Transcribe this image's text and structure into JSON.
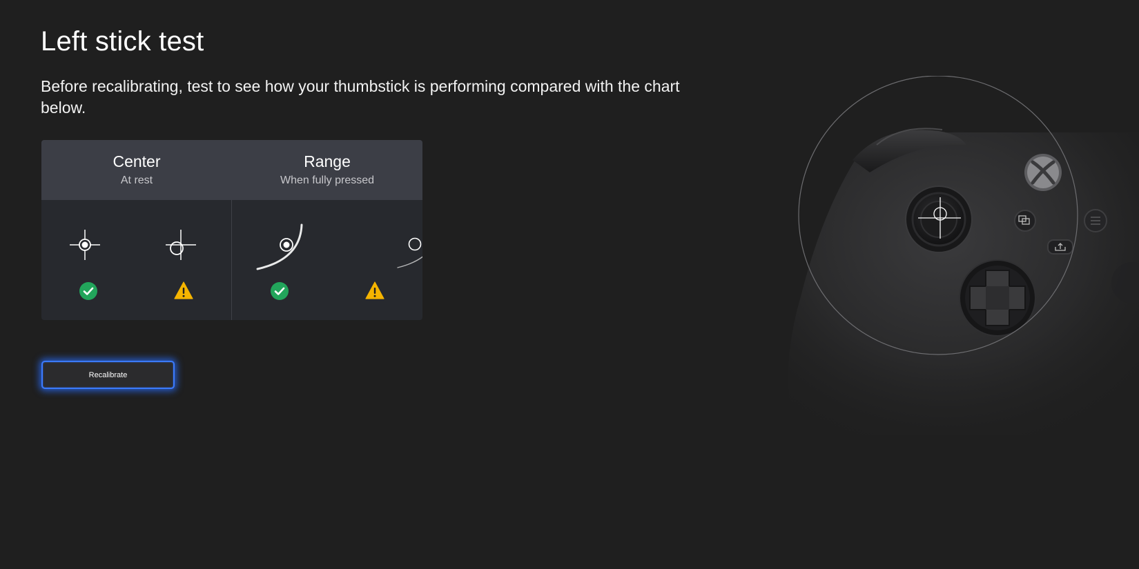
{
  "page": {
    "title": "Left stick test",
    "description": "Before recalibrating, test to see how your thumbstick is performing compared with the chart below."
  },
  "chart": {
    "columns": [
      {
        "title": "Center",
        "subtitle": "At rest"
      },
      {
        "title": "Range",
        "subtitle": "When fully pressed"
      }
    ],
    "examples": [
      {
        "kind": "center-ok",
        "status": "check-icon",
        "color": "#22a55b"
      },
      {
        "kind": "center-off",
        "status": "warning-icon",
        "color": "#f5b400"
      },
      {
        "kind": "range-ok",
        "status": "check-icon",
        "color": "#22a55b"
      },
      {
        "kind": "range-off",
        "status": "warning-icon",
        "color": "#f5b400"
      }
    ]
  },
  "actions": {
    "recalibrate_label": "Recalibrate",
    "focus_color": "#3b7bff"
  },
  "illustration": {
    "icon": "xbox-controller-illustration"
  }
}
